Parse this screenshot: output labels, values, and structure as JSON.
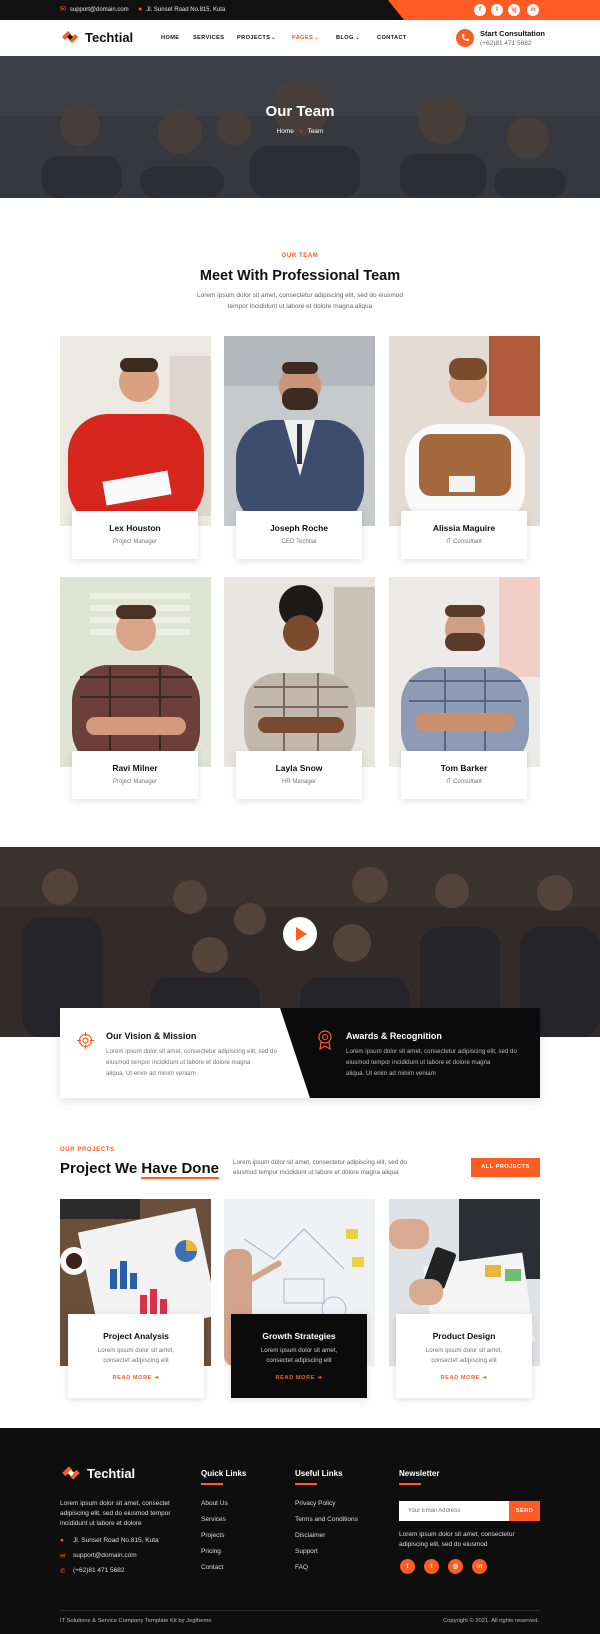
{
  "topbar": {
    "email": "support@domain.com",
    "address": "Jl. Sunset Road No.815, Kuta",
    "social": [
      "f",
      "t",
      "ig",
      "in"
    ]
  },
  "header": {
    "brand": "Techtial",
    "nav": [
      "HOME",
      "SERVICES",
      "PROJECTS",
      "PAGES",
      "BLOG",
      "CONTACT"
    ],
    "cta_title": "Start Consultation",
    "cta_phone": "(+62)81 471 5682",
    "accent": "#ff5b22"
  },
  "hero": {
    "title": "Our Team",
    "crumb_home": "Home",
    "crumb_sep": "›",
    "crumb_current": "Team"
  },
  "team": {
    "eyebrow": "OUR TEAM",
    "title": "Meet With Professional Team",
    "desc1": "Lorem ipsum dolor sit amet, consectetur adipiscing elit, sed do eiusmod",
    "desc2": "tempor incididunt ut labore et dolore magna aliqua",
    "members": [
      {
        "name": "Lex Houston",
        "role": "Project Manager"
      },
      {
        "name": "Joseph Roche",
        "role": "CEO Techtial"
      },
      {
        "name": "Alissia Maguire",
        "role": "IT Consultant"
      },
      {
        "name": "Ravi Milner",
        "role": "Project Manager"
      },
      {
        "name": "Layla Snow",
        "role": "HR Manager"
      },
      {
        "name": "Tom Barker",
        "role": "IT Consultant"
      }
    ]
  },
  "vision": {
    "title": "Our Vision & Mission",
    "l1": "Lorem ipsum dolor sit amet, consectetur adipiscing elit, sed do",
    "l2": "eiusmod tempor incididunt ut labore et dolore magna",
    "l3": "aliqua. Ut enim ad minim veniam"
  },
  "awards": {
    "title": "Awards & Recognition",
    "l1": "Lorem ipsum dolor sit amet, consectetur adipiscing elit, sed do",
    "l2": "eiusmod tempor incididunt ut labore et dolore magna",
    "l3": "aliqua. Ut enim ad minim veniam"
  },
  "projects": {
    "eyebrow": "OUR PROJECTS",
    "title_a": "Project We ",
    "title_b": "Have Done",
    "desc1": "Lorem ipsum dolor sit amet, consectetur adipiscing elit, sed do",
    "desc2": "eiusmod tempor incididunt ut labore et dolore magna aliqua",
    "button": "ALL PROJECTS",
    "items": [
      {
        "title": "Project Analysis",
        "desc": "Lorem ipsum dolor sit amet, consectet adipiscing elit",
        "more": "READ MORE"
      },
      {
        "title": "Growth Strategies",
        "desc": "Lorem ipsum dolor sit amet, consectet adipiscing elit",
        "more": "READ MORE"
      },
      {
        "title": "Product Design",
        "desc": "Lorem ipsum dolor sit amet, consectet adipiscing elit",
        "more": "READ MORE"
      }
    ]
  },
  "footer": {
    "brand": "Techtial",
    "about1": "Lorem ipsum dolor sit amet, consectet",
    "about2": "adipiscing elit, sed do eiusmod tempor",
    "about3": "incididunt ut labore et dolore",
    "address": "Jl. Sunset Road No.815, Kuta",
    "email": "support@domain.com",
    "phone": "(+62)81 471 5682",
    "quick_title": "Quick Links",
    "quick": [
      "About Us",
      "Services",
      "Projects",
      "Pricing",
      "Contact"
    ],
    "useful_title": "Useful Links",
    "useful": [
      "Privacy Policy",
      "Terms and Conditions",
      "Disclaimer",
      "Support",
      "FAQ"
    ],
    "news_title": "Newsletter",
    "news_placeholder": "Your Email Address",
    "news_button": "SEND",
    "news1": "Lorem ipsum dolor sit amet, consectetur",
    "news2": "adipiscing elit, sed do eiusmod",
    "copyright_left": "IT Solutions & Service Company Template Kit by Jegtheme",
    "copyright_right": "Copyright © 2021. All rights reserved."
  }
}
